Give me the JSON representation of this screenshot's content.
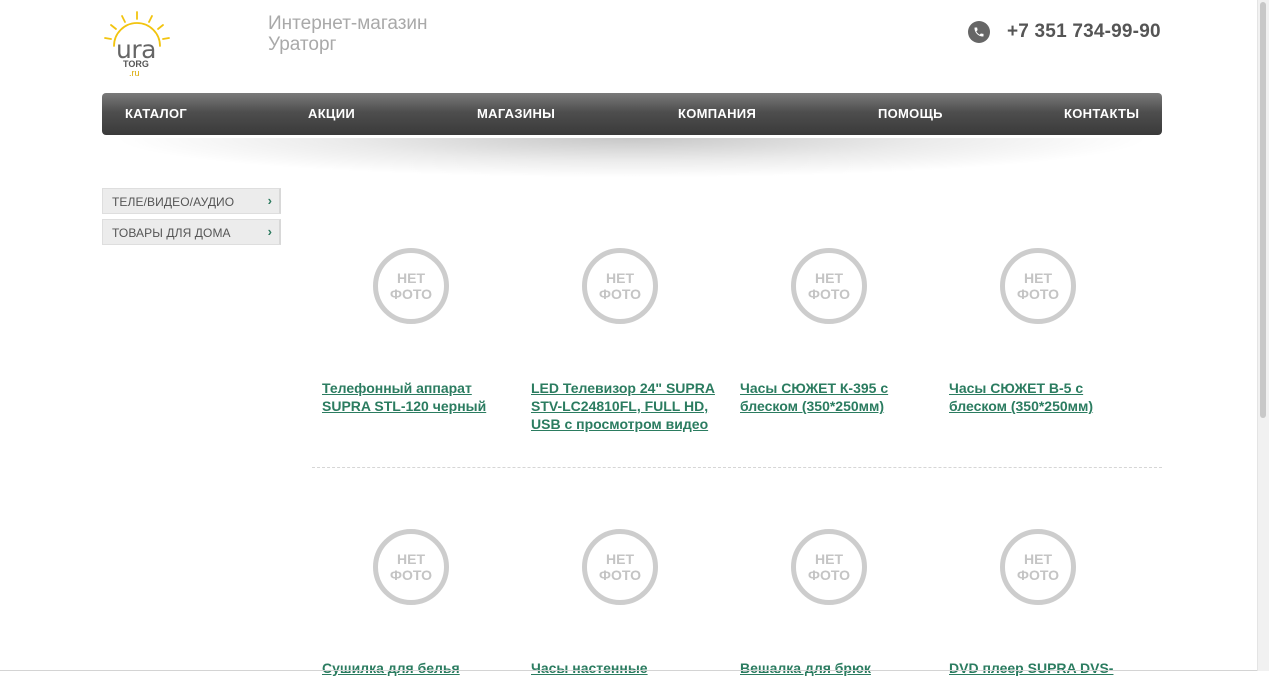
{
  "header": {
    "logo_text": "ura",
    "logo_sub": "TORG",
    "logo_domain": ".ru",
    "shop_name_line1": "Интернет-магазин",
    "shop_name_line2": "Ураторг",
    "phone": "+7 351 734-99-90"
  },
  "nav": [
    "КАТАЛОГ",
    "АКЦИИ",
    "МАГАЗИНЫ",
    "КОМПАНИЯ",
    "ПОМОЩЬ",
    "КОНТАКТЫ"
  ],
  "sidebar": [
    {
      "label": "ТЕЛЕ/ВИДЕО/АУДИО",
      "arrow": "›"
    },
    {
      "label": "ТОВАРЫ ДЛЯ ДОМА",
      "arrow": "›"
    }
  ],
  "no_photo": {
    "line1": "НЕТ",
    "line2": "ФОТО"
  },
  "products": [
    {
      "title": "Телефонный аппарат SUPRA STL-120 черный"
    },
    {
      "title": "LED Телевизор 24\" SUPRA STV-LC24810FL, FULL HD, USB с просмотром видео"
    },
    {
      "title": "Часы СЮЖЕТ К-395 с блеском (350*250мм)"
    },
    {
      "title": "Часы СЮЖЕТ В-5 с блеском (350*250мм)"
    },
    {
      "title": "Сушилка для белья"
    },
    {
      "title": "Часы настенные"
    },
    {
      "title": "Вешалка для брюк"
    },
    {
      "title": "DVD плеер SUPRA DVS-"
    }
  ],
  "colors": {
    "accent_link": "#2b7c60",
    "nav_bg": "#4e4e4e",
    "logo_yellow": "#f2c40f"
  }
}
